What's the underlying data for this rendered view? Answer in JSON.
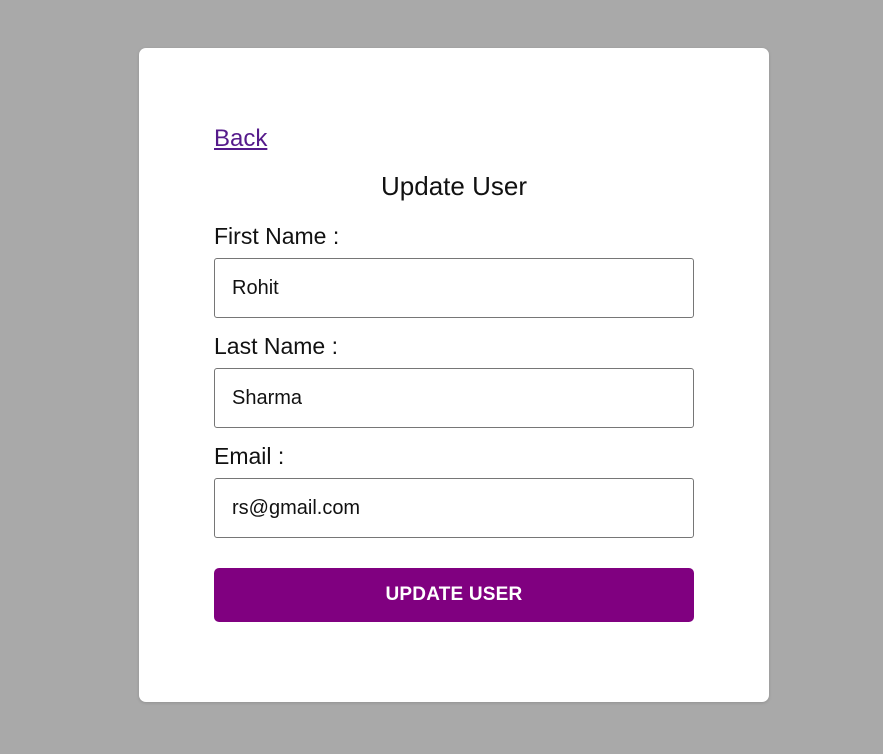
{
  "back_link": {
    "label": "Back"
  },
  "form": {
    "title": "Update User",
    "fields": [
      {
        "label": "First Name :",
        "value": "Rohit"
      },
      {
        "label": "Last Name :",
        "value": "Sharma"
      },
      {
        "label": "Email :",
        "value": "rs@gmail.com"
      }
    ],
    "submit_label": "UPDATE USER"
  },
  "colors": {
    "page_background": "#a9a9a9",
    "card_background": "#ffffff",
    "button_background": "#800080",
    "link": "#551a8b"
  }
}
